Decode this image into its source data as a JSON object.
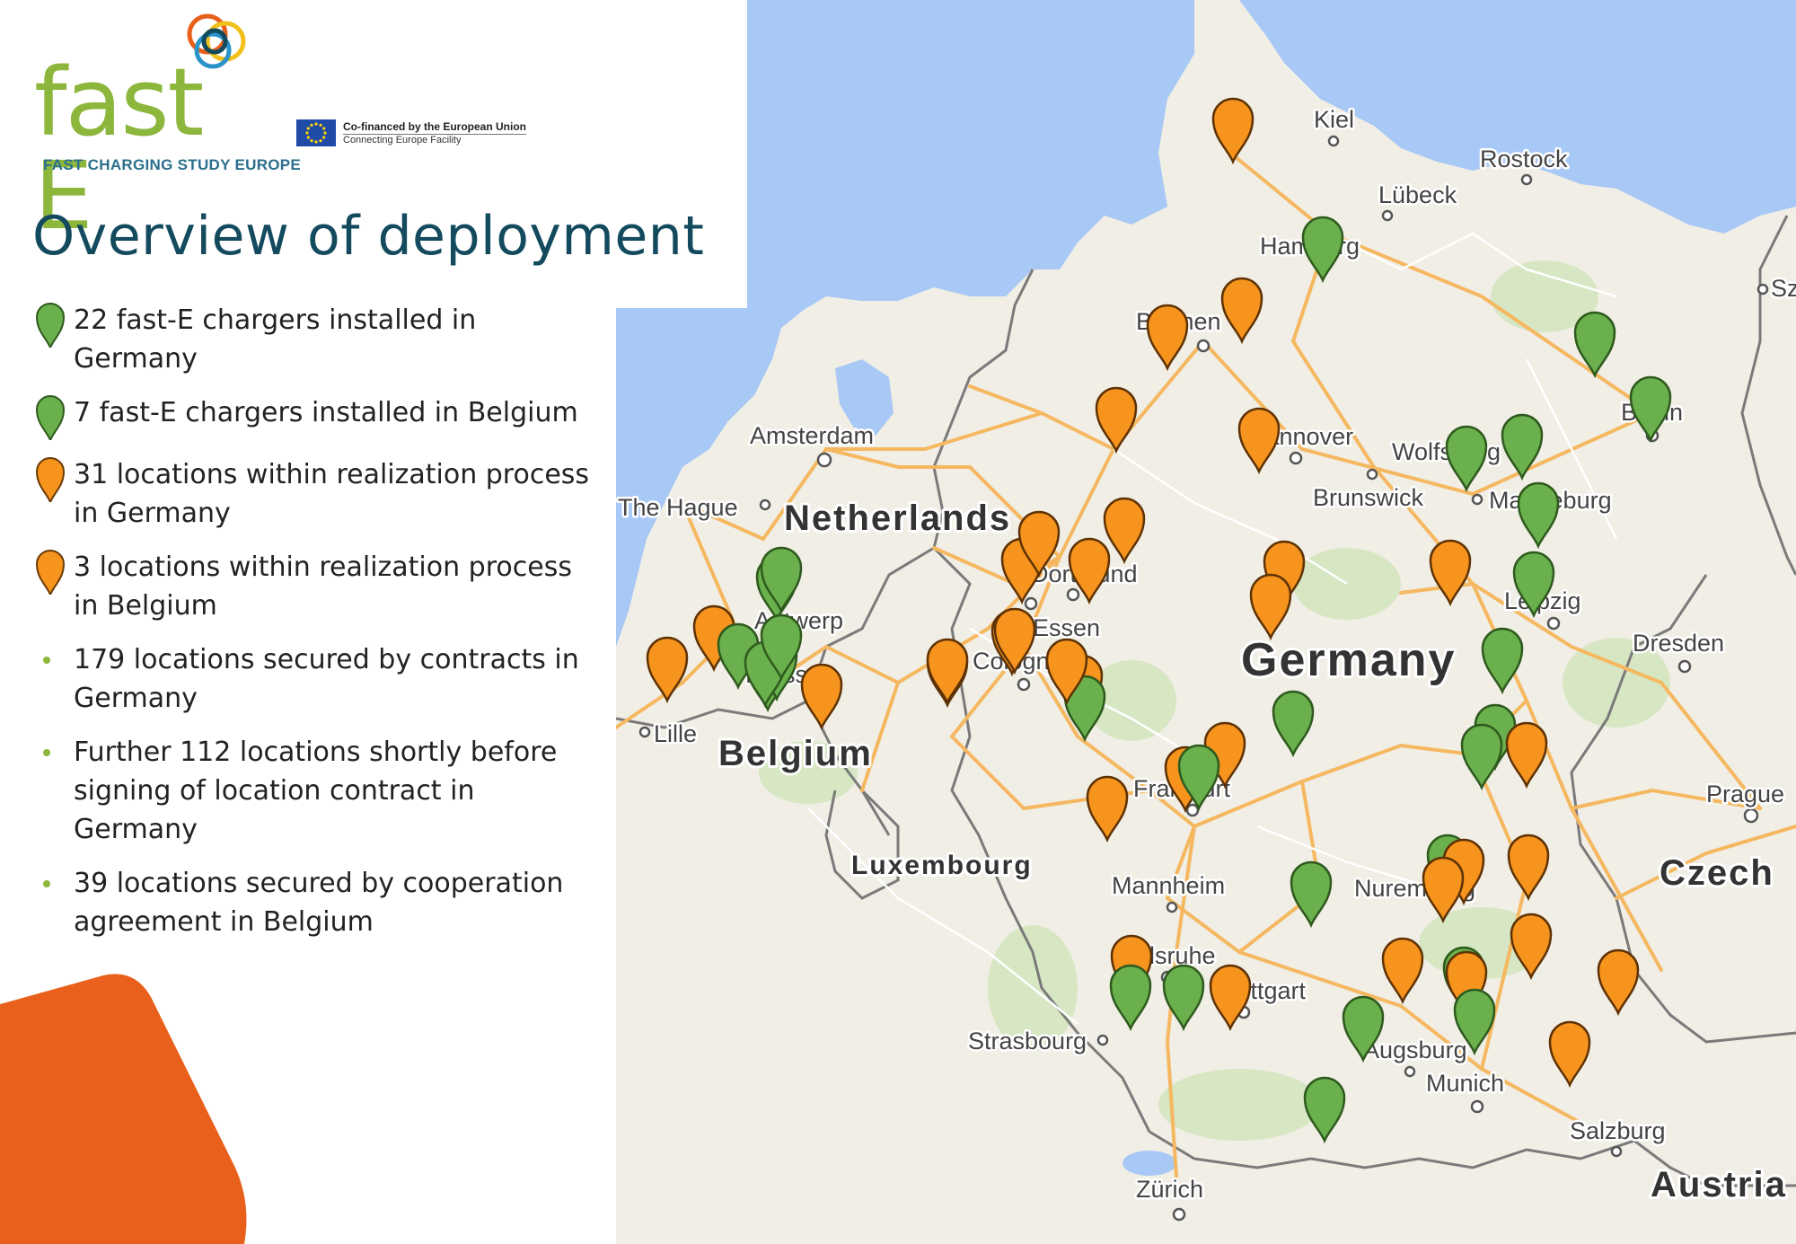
{
  "header": {
    "logo_word": "fast E",
    "logo_tagline": "FAST CHARGING STUDY EUROPE",
    "eu_line1": "Co-financed by the European Union",
    "eu_line2": "Connecting Europe Facility",
    "title": "Overview of deployment"
  },
  "colors": {
    "green_marker": "#6ab04c",
    "orange_marker": "#f7941d",
    "title": "#134a5e",
    "logo_green": "#8cb63c",
    "accent_orange": "#e8601c"
  },
  "legend": [
    {
      "marker": "green-marker-icon",
      "text": "22 fast-E chargers installed in Germany"
    },
    {
      "marker": "green-marker-icon",
      "text": "7 fast-E chargers installed in Belgium"
    },
    {
      "marker": "orange-marker-icon",
      "text": "31 locations within realization process in Germany"
    },
    {
      "marker": "orange-marker-icon",
      "text": "3 locations within realization process in Belgium"
    },
    {
      "marker": "dot",
      "text": "179 locations secured by contracts in Germany"
    },
    {
      "marker": "dot",
      "text": "Further 112 locations shortly before signing of location contract in Germany"
    },
    {
      "marker": "dot",
      "text": "39 locations secured by cooperation agreement in Belgium"
    }
  ],
  "map": {
    "countries": [
      "Netherlands",
      "Germany",
      "Belgium",
      "Luxembourg",
      "Czech",
      "Austria"
    ],
    "cities": [
      "Kiel",
      "Rostock",
      "Lübeck",
      "Hamburg",
      "Bremen",
      "Amsterdam",
      "Hannover",
      "Wolfsburg",
      "Berlin",
      "The Hague",
      "Brunswick",
      "Magdeburg",
      "Dortmund",
      "Leipzig",
      "Essen",
      "Dresden",
      "Cologne",
      "Lille",
      "Brussels",
      "Antwerp",
      "Frankfurt",
      "Prague",
      "Luxembourg",
      "Mannheim",
      "Nuremberg",
      "Karlsruhe",
      "Stuttgart",
      "Strasbourg",
      "Augsburg",
      "Munich",
      "Salzburg",
      "Zürich",
      "Szczecin"
    ]
  }
}
